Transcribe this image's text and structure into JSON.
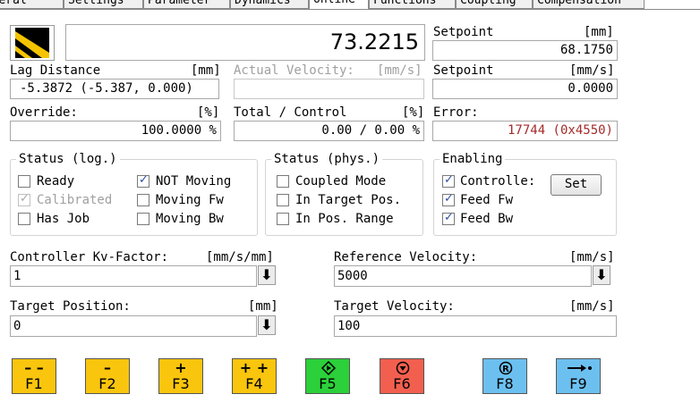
{
  "tabs": [
    {
      "label": "General",
      "active": false
    },
    {
      "label": "Settings",
      "active": false
    },
    {
      "label": "Parameter",
      "active": false
    },
    {
      "label": "Dynamics",
      "active": false
    },
    {
      "label": "Online",
      "active": true
    },
    {
      "label": "Functions",
      "active": false
    },
    {
      "label": "Coupling",
      "active": false
    },
    {
      "label": "Compensation",
      "active": false
    }
  ],
  "position": {
    "value": "73.2215"
  },
  "setpoint_pos": {
    "label": "Setpoint",
    "unit": "[mm]",
    "value": "68.1750"
  },
  "lag": {
    "label": "Lag Distance",
    "unit": "[mm]",
    "value": "-5.3872  (-5.387, 0.000)"
  },
  "actual_velocity": {
    "label": "Actual Velocity:",
    "unit": "[mm/s]",
    "value": ""
  },
  "setpoint_vel": {
    "label": "Setpoint",
    "unit": "[mm/s]",
    "value": "0.0000"
  },
  "override": {
    "label": "Override:",
    "unit": "[%]",
    "value": "100.0000 %"
  },
  "total_control": {
    "label": "Total / Control",
    "unit": "[%]",
    "value": "0.00 /  0.00 %"
  },
  "error": {
    "label": "Error:",
    "value": "17744 (0x4550)",
    "color": "#a52a2a"
  },
  "status_log": {
    "title": "Status (log.)",
    "items": [
      {
        "label": "Ready",
        "checked": false,
        "disabled": false
      },
      {
        "label": "Calibrated",
        "checked": true,
        "disabled": true
      },
      {
        "label": "Has Job",
        "checked": false,
        "disabled": false
      },
      {
        "label": "NOT Moving",
        "checked": true,
        "disabled": false
      },
      {
        "label": "Moving Fw",
        "checked": false,
        "disabled": false
      },
      {
        "label": "Moving Bw",
        "checked": false,
        "disabled": false
      }
    ]
  },
  "status_phys": {
    "title": "Status (phys.)",
    "items": [
      {
        "label": "Coupled Mode",
        "checked": false
      },
      {
        "label": "In Target Pos.",
        "checked": false
      },
      {
        "label": "In Pos. Range",
        "checked": false
      }
    ]
  },
  "enabling": {
    "title": "Enabling",
    "items": [
      {
        "label": "Controlle:",
        "checked": true
      },
      {
        "label": "Feed Fw",
        "checked": true
      },
      {
        "label": "Feed Bw",
        "checked": true
      }
    ],
    "set_label": "Set"
  },
  "kv": {
    "label": "Controller Kv-Factor:",
    "unit": "[mm/s/mm]",
    "value": "1"
  },
  "ref_vel": {
    "label": "Reference Velocity:",
    "unit": "[mm/s]",
    "value": "5000"
  },
  "target_pos": {
    "label": "Target Position:",
    "unit": "[mm]",
    "value": "0"
  },
  "target_vel": {
    "label": "Target Velocity:",
    "unit": "[mm/s]",
    "value": "100"
  },
  "fkeys": [
    {
      "label": "F1",
      "symbol": "– –",
      "color": "#f9c50d",
      "icon": "fast-backward-icon"
    },
    {
      "label": "F2",
      "symbol": "–",
      "color": "#f9c50d",
      "icon": "backward-icon"
    },
    {
      "label": "F3",
      "symbol": "+",
      "color": "#f9c50d",
      "icon": "forward-icon"
    },
    {
      "label": "F4",
      "symbol": "+ +",
      "color": "#f9c50d",
      "icon": "fast-forward-icon"
    },
    {
      "label": "F5",
      "symbol": "",
      "color": "#2bd03a",
      "icon": "start-icon"
    },
    {
      "label": "F6",
      "symbol": "",
      "color": "#f25f4f",
      "icon": "stop-icon"
    },
    {
      "label": "F8",
      "symbol": "",
      "color": "#6cc0f0",
      "icon": "reset-icon"
    },
    {
      "label": "F9",
      "symbol": "",
      "color": "#6cc0f0",
      "icon": "move-to-target-icon"
    }
  ]
}
